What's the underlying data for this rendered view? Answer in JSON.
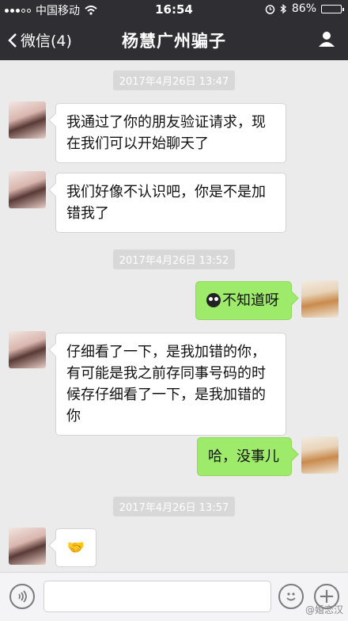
{
  "status": {
    "carrier": "中国移动",
    "time": "16:54",
    "battery": "86%",
    "battery_level": 0.86
  },
  "nav": {
    "back_label": "微信(4)",
    "title": "杨慧广州骗子"
  },
  "timestamps": [
    "2017年4月26日 13:47",
    "2017年4月26日 13:52",
    "2017年4月26日 13:57"
  ],
  "messages": [
    {
      "side": "left",
      "text": "我通过了你的朋友验证请求，现在我们可以开始聊天了"
    },
    {
      "side": "left",
      "text": "我们好像不认识吧，你是不是加错我了"
    },
    {
      "side": "right",
      "text": "不知道呀",
      "emoji": "dark-face-icon"
    },
    {
      "side": "left",
      "text": "仔细看了一下，是我加错的你，有可能是我之前存同事号码的时候存仔细看了一下，是我加错的你"
    },
    {
      "side": "right",
      "text": "哈，没事儿"
    },
    {
      "side": "left",
      "text": "🤝"
    }
  ],
  "input": {
    "placeholder": ""
  },
  "watermark": "@婚恋汉"
}
